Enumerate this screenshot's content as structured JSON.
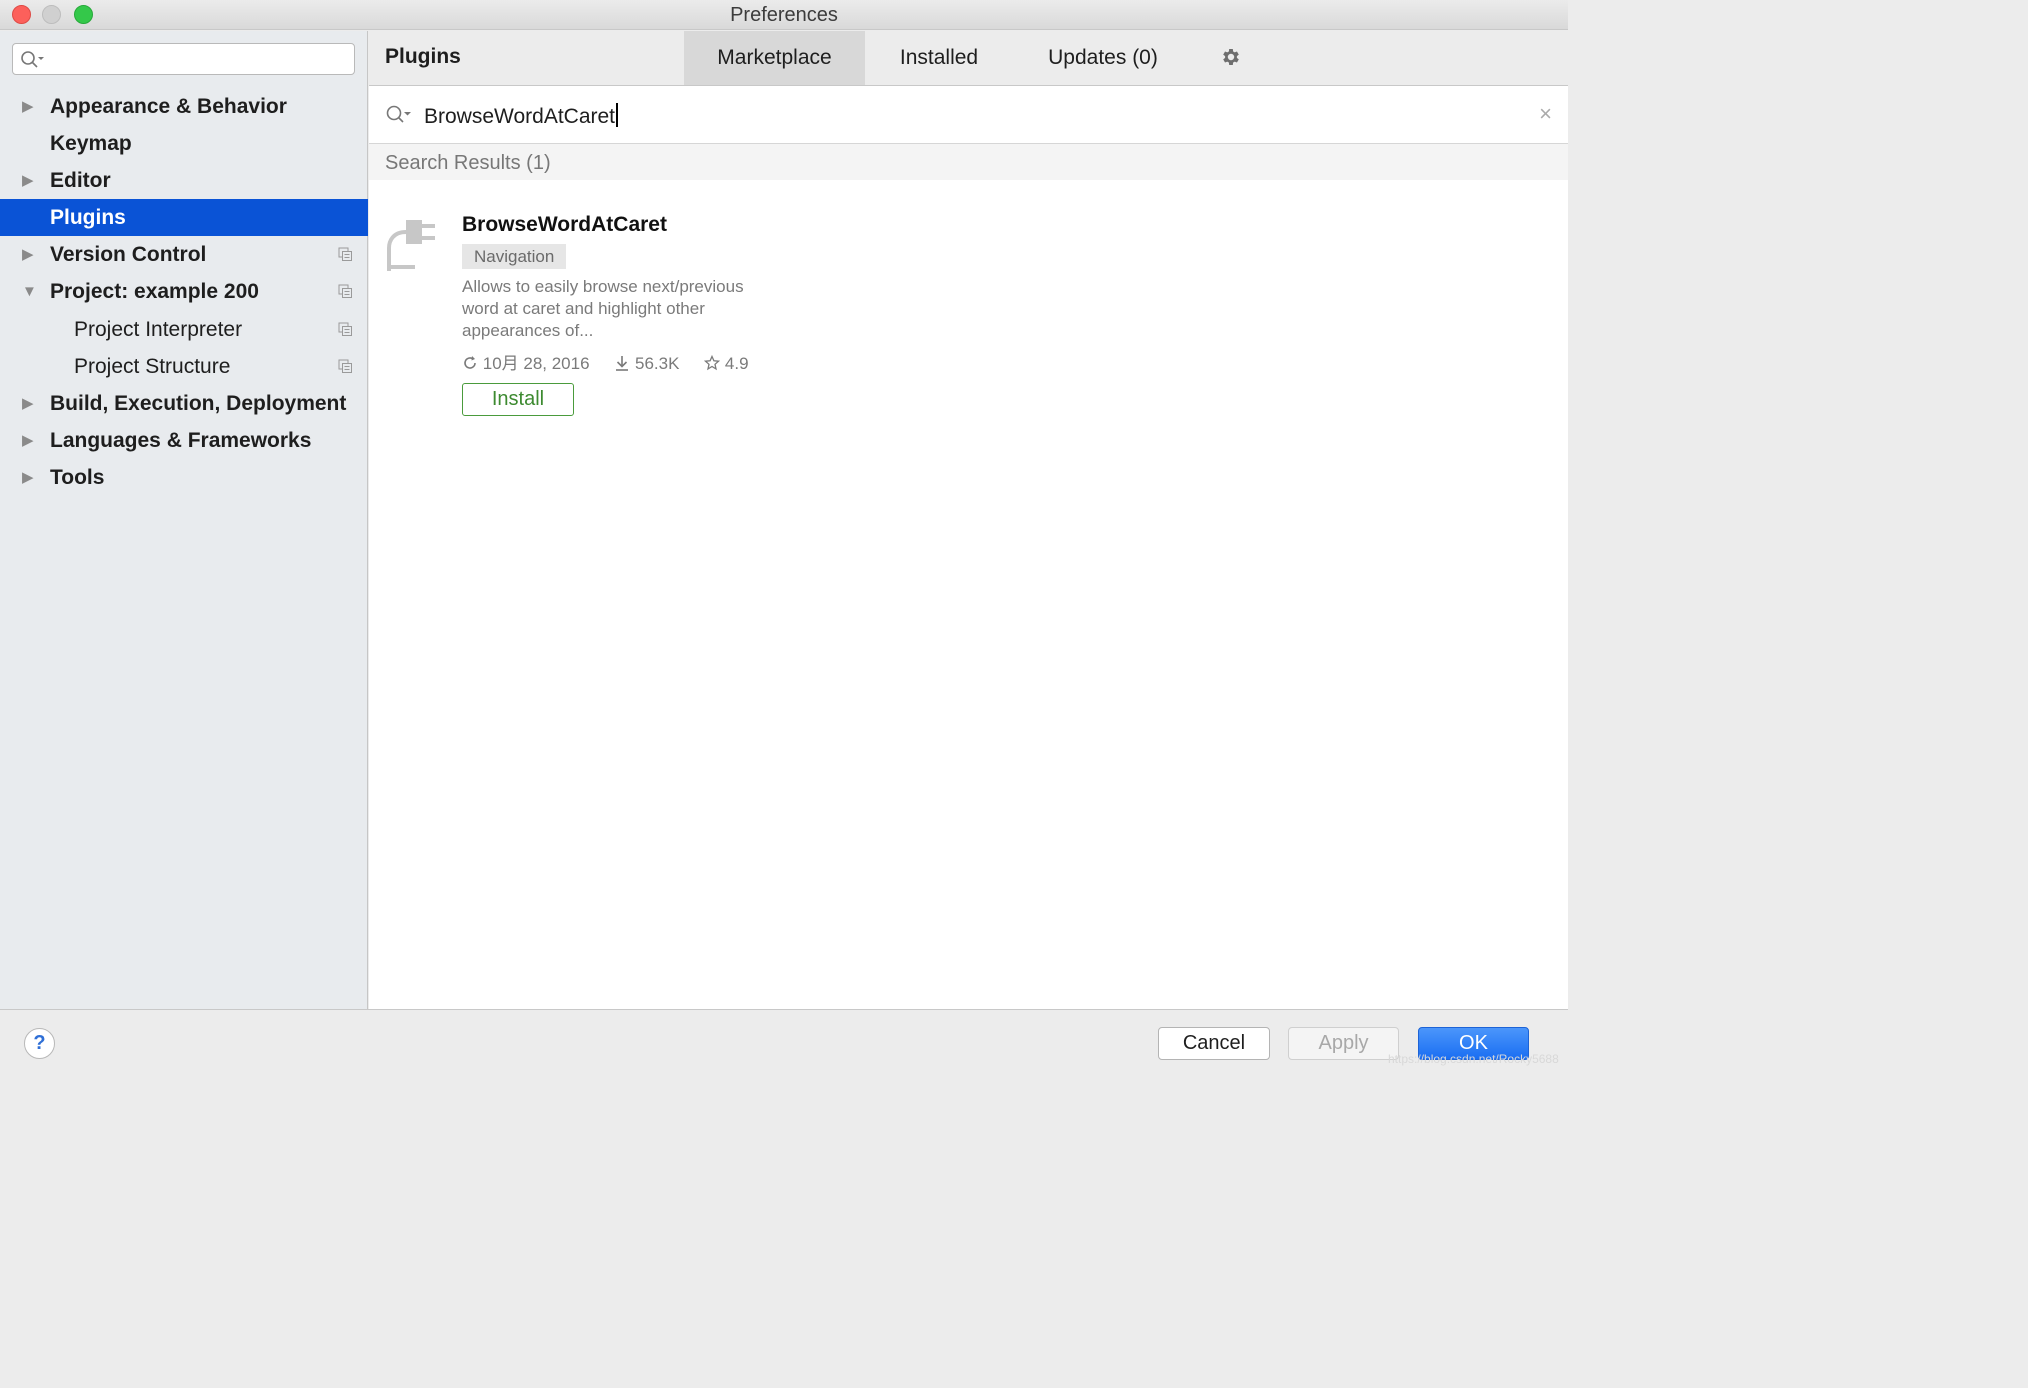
{
  "window": {
    "title": "Preferences"
  },
  "sidebar": {
    "search_placeholder": "",
    "items": [
      {
        "label": "Appearance & Behavior",
        "arrow": "▶"
      },
      {
        "label": "Keymap",
        "arrow": ""
      },
      {
        "label": "Editor",
        "arrow": "▶"
      },
      {
        "label": "Plugins",
        "arrow": ""
      },
      {
        "label": "Version Control",
        "arrow": "▶"
      },
      {
        "label": "Project: example 200",
        "arrow": "▼"
      },
      {
        "label": "Project Interpreter",
        "arrow": ""
      },
      {
        "label": "Project Structure",
        "arrow": ""
      },
      {
        "label": "Build, Execution, Deployment",
        "arrow": "▶"
      },
      {
        "label": "Languages & Frameworks",
        "arrow": "▶"
      },
      {
        "label": "Tools",
        "arrow": "▶"
      }
    ]
  },
  "header": {
    "title": "Plugins",
    "tabs": {
      "marketplace": "Marketplace",
      "installed": "Installed",
      "updates": "Updates (0)"
    }
  },
  "search": {
    "query": "BrowseWordAtCaret",
    "clear": "×"
  },
  "results": {
    "label": "Search Results (1)"
  },
  "plugin": {
    "name": "BrowseWordAtCaret",
    "tag": "Navigation",
    "description": "Allows to easily browse next/previous word at caret and highlight other appearances of...",
    "date": "10月 28, 2016",
    "downloads": "56.3K",
    "rating": "4.9",
    "install_label": "Install"
  },
  "footer": {
    "help": "?",
    "cancel": "Cancel",
    "apply": "Apply",
    "ok": "OK",
    "watermark": "https://blog.csdn.net/Rocky5688"
  },
  "colors": {
    "selection": "#0a53d6",
    "install_green": "#3d8a30",
    "ok_blue": "#1a6ef2"
  },
  "icons": [
    "search-icon",
    "gear-icon",
    "plug-icon",
    "refresh-icon",
    "download-icon",
    "star-icon",
    "copy-icon",
    "help-icon"
  ]
}
